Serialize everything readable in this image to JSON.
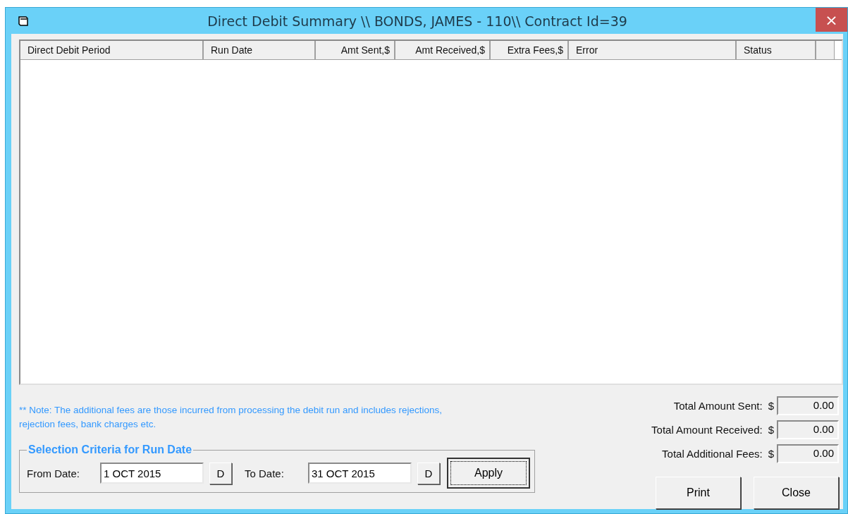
{
  "window": {
    "title": "Direct Debit Summary \\\\ BONDS, JAMES - 110\\\\ Contract Id=39",
    "close": "×"
  },
  "table": {
    "columns": [
      {
        "label": "Direct Debit Period"
      },
      {
        "label": "Run Date"
      },
      {
        "label": "Amt Sent,$"
      },
      {
        "label": "Amt Received,$"
      },
      {
        "label": "Extra Fees,$"
      },
      {
        "label": "Error"
      },
      {
        "label": "Status"
      }
    ]
  },
  "note": "** Note: The additional fees are those incurred from processing the debit run and includes rejections, rejection fees, bank charges etc.",
  "selection": {
    "legend": "Selection Criteria for Run Date",
    "from": {
      "label": "From Date:",
      "value": "1 OCT 2015",
      "button": "D"
    },
    "to": {
      "label": "To Date:",
      "value": "31 OCT 2015",
      "button": "D"
    },
    "apply": "Apply"
  },
  "totals": [
    {
      "label": "Total Amount Sent:",
      "currency": "$",
      "value": "0.00"
    },
    {
      "label": "Total Amount Received:",
      "currency": "$",
      "value": "0.00"
    },
    {
      "label": "Total Additional Fees:",
      "currency": "$",
      "value": "0.00"
    }
  ],
  "buttons": [
    "Print",
    "Close"
  ]
}
